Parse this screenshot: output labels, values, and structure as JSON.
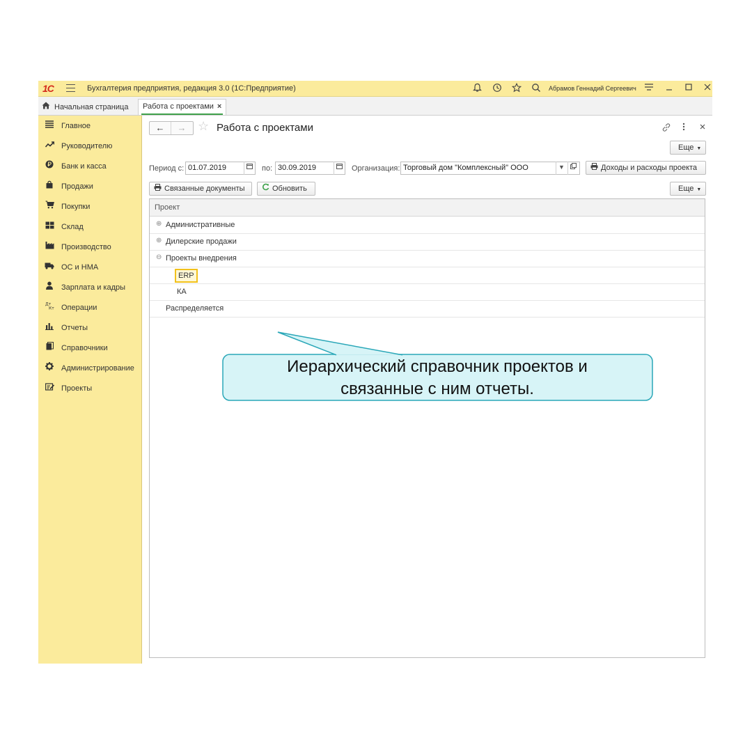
{
  "titlebar": {
    "logo": "1С",
    "app_title": "Бухгалтерия предприятия, редакция 3.0  (1С:Предприятие)",
    "user": "Абрамов Геннадий Сергеевич"
  },
  "tabs": {
    "home": "Начальная страница",
    "active": "Работа с проектами",
    "close": "×"
  },
  "sidebar": {
    "items": [
      {
        "label": "Главное",
        "icon": "menu-icon"
      },
      {
        "label": "Руководителю",
        "icon": "trend-icon"
      },
      {
        "label": "Банк и касса",
        "icon": "ruble-icon"
      },
      {
        "label": "Продажи",
        "icon": "bag-icon"
      },
      {
        "label": "Покупки",
        "icon": "cart-icon"
      },
      {
        "label": "Склад",
        "icon": "warehouse-icon"
      },
      {
        "label": "Производство",
        "icon": "factory-icon"
      },
      {
        "label": "ОС и НМА",
        "icon": "truck-icon"
      },
      {
        "label": "Зарплата и кадры",
        "icon": "person-icon"
      },
      {
        "label": "Операции",
        "icon": "dt-kt-icon"
      },
      {
        "label": "Отчеты",
        "icon": "bar-chart-icon"
      },
      {
        "label": "Справочники",
        "icon": "books-icon"
      },
      {
        "label": "Администрирование",
        "icon": "gear-icon"
      },
      {
        "label": "Проекты",
        "icon": "projects-icon"
      }
    ]
  },
  "form": {
    "title": "Работа с проектами",
    "more_label": "Еще",
    "period_from_label": "Период с:",
    "period_from": "01.07.2019",
    "period_to_label": "по:",
    "period_to": "30.09.2019",
    "org_label": "Организация:",
    "org_value": "Торговый дом \"Комплексный\" ООО",
    "report_button": "Доходы и расходы проекта",
    "related_docs_button": "Связанные документы",
    "refresh_button": "Обновить"
  },
  "table": {
    "column": "Проект",
    "rows": [
      {
        "label": "Административные",
        "expander": "⊕"
      },
      {
        "label": "Дилерские продажи",
        "expander": "⊕"
      },
      {
        "label": "Проекты внедрения",
        "expander": "⊖"
      },
      {
        "label": "ERP",
        "expander": ""
      },
      {
        "label": "КА",
        "expander": ""
      },
      {
        "label": "Распределяется",
        "expander": ""
      }
    ]
  },
  "callout": {
    "line1": "Иерархический справочник проектов и",
    "line2": "связанные с ним отчеты."
  },
  "colors": {
    "sidebar": "#fbeb9c",
    "callout_fill": "#d7f4f7",
    "callout_border": "#2aa7b8",
    "selection_border": "#f2c11b",
    "accent_green": "#3fa14b"
  }
}
